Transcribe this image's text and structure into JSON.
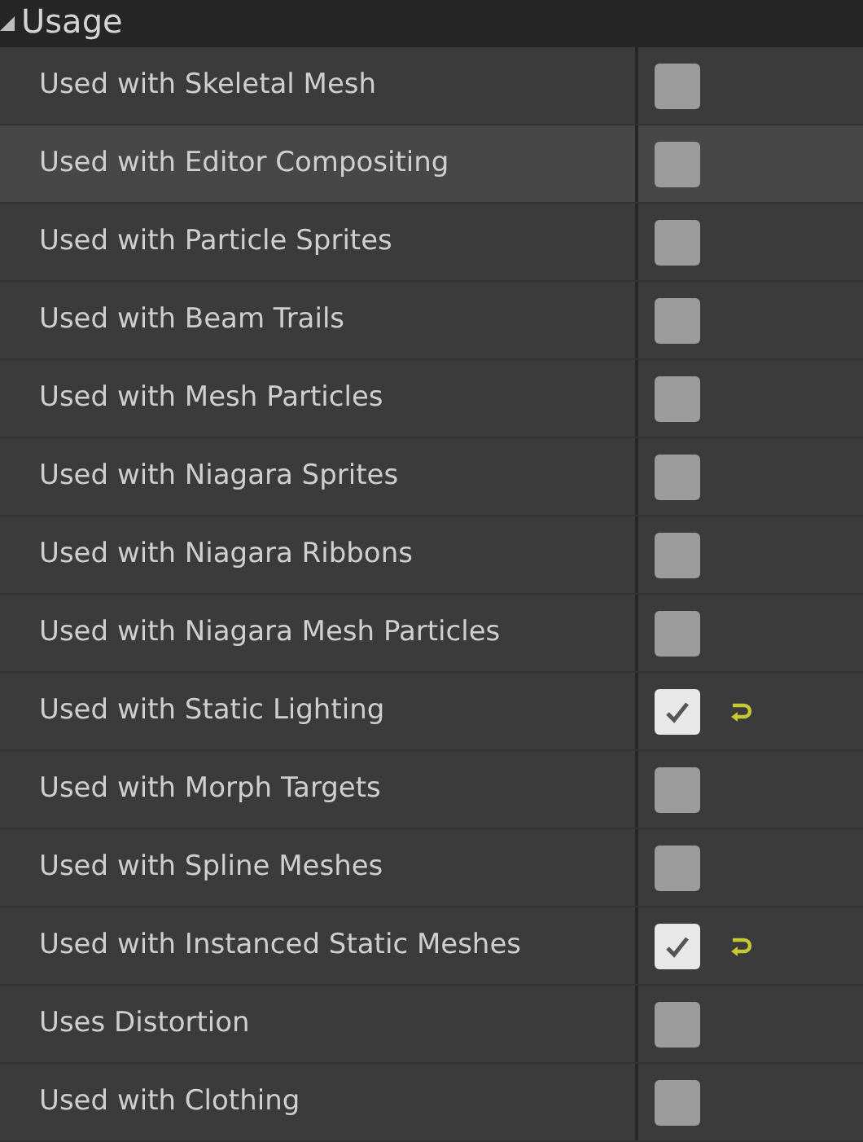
{
  "section": {
    "title": "Usage",
    "expanded": true
  },
  "rows": [
    {
      "label": "Used with Skeletal Mesh",
      "checked": false,
      "modified": false,
      "highlighted": false
    },
    {
      "label": "Used with Editor Compositing",
      "checked": false,
      "modified": false,
      "highlighted": true
    },
    {
      "label": "Used with Particle Sprites",
      "checked": false,
      "modified": false,
      "highlighted": false
    },
    {
      "label": "Used with Beam Trails",
      "checked": false,
      "modified": false,
      "highlighted": false
    },
    {
      "label": "Used with Mesh Particles",
      "checked": false,
      "modified": false,
      "highlighted": false
    },
    {
      "label": "Used with Niagara Sprites",
      "checked": false,
      "modified": false,
      "highlighted": false
    },
    {
      "label": "Used with Niagara Ribbons",
      "checked": false,
      "modified": false,
      "highlighted": false
    },
    {
      "label": "Used with Niagara Mesh Particles",
      "checked": false,
      "modified": false,
      "highlighted": false
    },
    {
      "label": "Used with Static Lighting",
      "checked": true,
      "modified": true,
      "highlighted": false
    },
    {
      "label": "Used with Morph Targets",
      "checked": false,
      "modified": false,
      "highlighted": false
    },
    {
      "label": "Used with Spline Meshes",
      "checked": false,
      "modified": false,
      "highlighted": false
    },
    {
      "label": "Used with Instanced Static Meshes",
      "checked": true,
      "modified": true,
      "highlighted": false
    },
    {
      "label": "Uses Distortion",
      "checked": false,
      "modified": false,
      "highlighted": false
    },
    {
      "label": "Used with Clothing",
      "checked": false,
      "modified": false,
      "highlighted": false
    }
  ]
}
